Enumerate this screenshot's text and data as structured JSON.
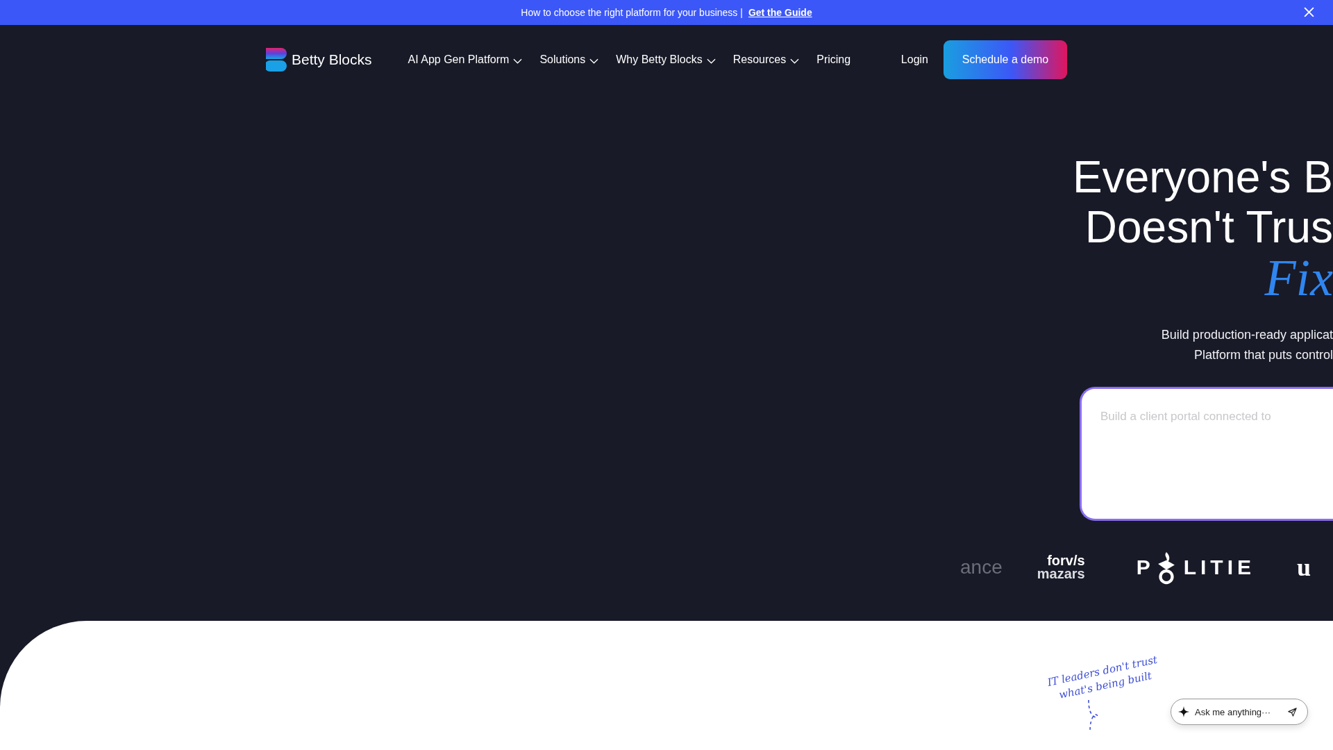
{
  "banner": {
    "text": "How to choose the right platform for your business |",
    "link": "Get the Guide"
  },
  "brand": "Betty Blocks",
  "nav": [
    {
      "label": "AI App Gen Platform",
      "dropdown": true
    },
    {
      "label": "Solutions",
      "dropdown": true
    },
    {
      "label": "Why Betty Blocks",
      "dropdown": true
    },
    {
      "label": "Resources",
      "dropdown": true
    },
    {
      "label": "Pricing",
      "dropdown": false
    }
  ],
  "login": "Login",
  "cta": "Schedule a demo",
  "hero": {
    "heading_lines": [
      "Everyone's B",
      "Doesn't Trus"
    ],
    "highlight": "Fix",
    "subtitle_lines": [
      "Build production-ready applicat",
      "Platform that puts control"
    ],
    "prompt": {
      "placeholder": "Build a client portal connected to"
    }
  },
  "logos": [
    {
      "kind": "faded",
      "text": "ance"
    },
    {
      "kind": "stacked",
      "lines": [
        "forv/s",
        "mazars"
      ]
    },
    {
      "kind": "emblem",
      "before": "P",
      "after": "LITIE"
    },
    {
      "kind": "serif",
      "text": "u"
    }
  ],
  "note": "IT leaders don't trust what's being built",
  "chat": {
    "placeholder": "Ask me anything···"
  }
}
